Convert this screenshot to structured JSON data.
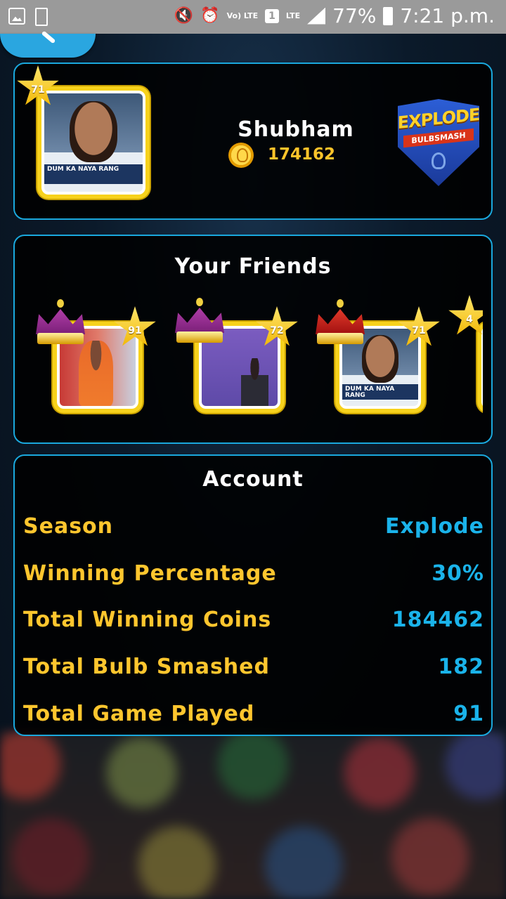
{
  "status_bar": {
    "network": "LTE",
    "volte": "Vo) LTE",
    "sim_slot": "1",
    "battery": "77%",
    "time": "7:21 p.m."
  },
  "profile": {
    "name": "Shubham",
    "coins": "174162",
    "level": "71",
    "badge_title": "EXPLODE",
    "badge_subtitle": "BULBSMASH",
    "avatar_caption": "DUM KA NAYA RANG"
  },
  "friends": {
    "title": "Your Friends",
    "items": [
      {
        "level": "91",
        "crown": "purple",
        "photo": "orange"
      },
      {
        "level": "72",
        "crown": "purple",
        "photo": "purple"
      },
      {
        "level": "71",
        "crown": "red",
        "photo": "dhoni",
        "caption": "DUM KA NAYA RANG"
      },
      {
        "level": "4"
      }
    ]
  },
  "account": {
    "title": "Account",
    "rows": [
      {
        "label": "Season",
        "value": "Explode"
      },
      {
        "label": "Winning Percentage",
        "value": "30%"
      },
      {
        "label": "Total Winning Coins",
        "value": "184462"
      },
      {
        "label": "Total Bulb Smashed",
        "value": "182"
      },
      {
        "label": "Total Game Played",
        "value": "91"
      }
    ]
  },
  "colors": {
    "accent": "#1aa8dd",
    "label_yellow": "#ffc62e",
    "value_blue": "#1ab3ea"
  }
}
